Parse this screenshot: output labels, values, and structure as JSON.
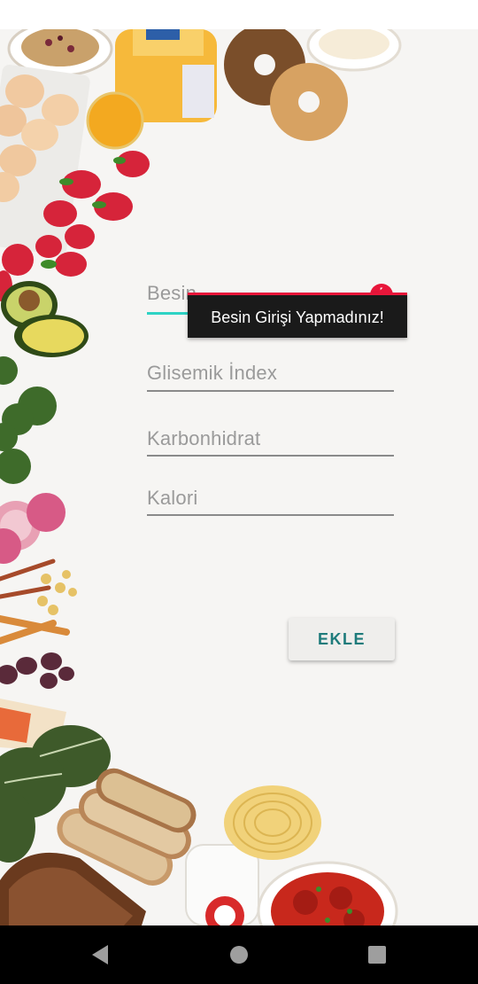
{
  "form": {
    "fields": [
      {
        "label": "Besin",
        "focused": true,
        "has_error": true
      },
      {
        "label": "Glisemik İndex"
      },
      {
        "label": "Karbonhidrat"
      },
      {
        "label": "Kalori"
      }
    ],
    "error_message": "Besin Girişi Yapmadınız!",
    "error_icon": "!",
    "submit_label": "EKLE"
  },
  "navigation": {
    "buttons": [
      "back-icon",
      "home-icon",
      "recents-icon"
    ]
  },
  "colors": {
    "accent": "#2ed3c4",
    "error": "#e8163a",
    "button_text": "#1e7b7b",
    "nav_bar": "#000000",
    "background": "#f6f5f3"
  }
}
